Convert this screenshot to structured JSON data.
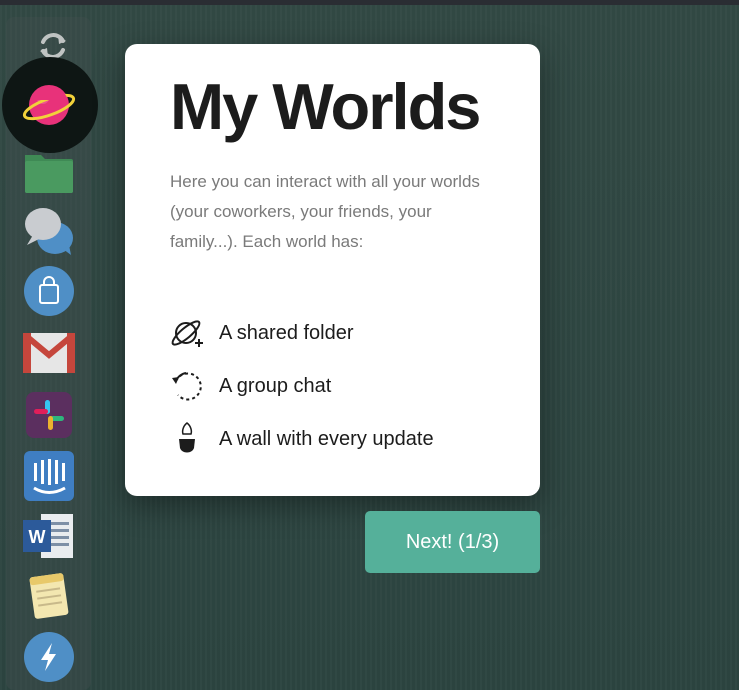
{
  "dock": {
    "items": [
      {
        "name": "refresh-icon"
      },
      {
        "name": "worlds-planet-icon"
      },
      {
        "name": "folder-icon"
      },
      {
        "name": "chat-bubbles-icon"
      },
      {
        "name": "shopping-bag-icon"
      },
      {
        "name": "gmail-icon"
      },
      {
        "name": "slack-icon"
      },
      {
        "name": "intercom-icon"
      },
      {
        "name": "word-icon"
      },
      {
        "name": "notes-icon"
      },
      {
        "name": "lightning-icon"
      }
    ]
  },
  "tutorial": {
    "title": "My Worlds",
    "description": "Here you can interact with all your worlds (your coworkers, your friends, your family...). Each world has:",
    "features": [
      {
        "icon": "planet-plus-icon",
        "label": "A shared folder"
      },
      {
        "icon": "group-chat-icon",
        "label": "A group chat"
      },
      {
        "icon": "wall-update-icon",
        "label": "A wall with every update"
      }
    ],
    "next_label": "Next! (1/3)"
  },
  "colors": {
    "background": "#2e4541",
    "accent": "#55b09a",
    "card": "#ffffff",
    "planet": "#e8327a",
    "ring": "#f2d23a"
  }
}
